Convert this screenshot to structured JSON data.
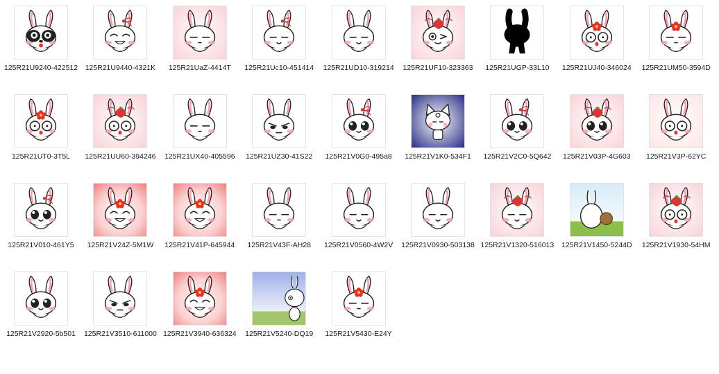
{
  "window": {
    "view": "file-explorer-thumbnails"
  },
  "colors": {
    "caption_text": "#1a1a1a",
    "thumb_border": "#e3e3e3",
    "pink_bg": "#f9d3d8",
    "blush": "#f7a2ad",
    "ribbon": "#cf3b3b",
    "flower": "#e8302a",
    "sky": "#b8c7ee",
    "grass": "#8cbf4a"
  },
  "files": [
    {
      "name": "125R21U9240-422512",
      "icon": "panda-bunny-icon",
      "bg": "white",
      "variant": "panda"
    },
    {
      "name": "125R21U9440-4321K",
      "icon": "bunny-grin-bow-icon",
      "bg": "white",
      "variant": "grin",
      "accessory": "bow"
    },
    {
      "name": "125R21UaZ-4414T",
      "icon": "bunny-flat-pink-icon",
      "bg": "pink",
      "variant": "flat"
    },
    {
      "name": "125R21Uc10-451414",
      "icon": "bunny-smile-bow-icon",
      "bg": "white",
      "variant": "smile",
      "accessory": "bow"
    },
    {
      "name": "125R21UD10-319214",
      "icon": "bunny-wave-icon",
      "bg": "white",
      "variant": "smile"
    },
    {
      "name": "125R21UF10-323363",
      "icon": "bunny-wink-pink-icon",
      "bg": "pink",
      "variant": "wink",
      "accessory": "strawberry"
    },
    {
      "name": "125R21UGP-33L10",
      "icon": "bunny-silhouette-icon",
      "bg": "white",
      "variant": "silhouette"
    },
    {
      "name": "125R21UJ40-346024",
      "icon": "bunny-scared-flower-icon",
      "bg": "white",
      "variant": "wide",
      "accessory": "flower"
    },
    {
      "name": "125R21UM50-3594D",
      "icon": "bunny-sweat-flower-icon",
      "bg": "white",
      "variant": "flat",
      "accessory": "flower"
    },
    {
      "name": "125R21UT0-3T5L",
      "icon": "bunny-stare-flower-icon",
      "bg": "white",
      "variant": "wide",
      "accessory": "flower"
    },
    {
      "name": "125R21UU60-394246",
      "icon": "bunny-shock-pink-icon",
      "bg": "pink",
      "variant": "wide",
      "accessory": "strawberry"
    },
    {
      "name": "125R21UX40-405596",
      "icon": "bunny-carrot-icon",
      "bg": "white",
      "variant": "flat"
    },
    {
      "name": "125R21UZ30-41S22",
      "icon": "bunny-angry-icon",
      "bg": "white",
      "variant": "angry"
    },
    {
      "name": "125R21V0G0-495a8",
      "icon": "bunny-teary-bow-icon",
      "bg": "white",
      "variant": "big",
      "accessory": "bow"
    },
    {
      "name": "125R21V1K0-534F1",
      "icon": "cat-costume-icon",
      "bg": "navy",
      "variant": "cat"
    },
    {
      "name": "125R21V2C0-5Q642",
      "icon": "bunny-cry-bow-icon",
      "bg": "white",
      "variant": "big",
      "accessory": "bow"
    },
    {
      "name": "125R21V03P-4G603",
      "icon": "bunny-surprise-pink-icon",
      "bg": "pink",
      "variant": "big",
      "accessory": "strawberry"
    },
    {
      "name": "125R21V3P-62YC",
      "icon": "bunny-round-eyes-icon",
      "bg": "pinklight",
      "variant": "wide"
    },
    {
      "name": "125R21V010-461Y5",
      "icon": "bunny-teary-icon",
      "bg": "white",
      "variant": "big",
      "accessory": "bow"
    },
    {
      "name": "125R21V24Z-5M1W",
      "icon": "bunny-laugh-flower-icon",
      "bg": "pinkglow",
      "variant": "grin",
      "accessory": "flower"
    },
    {
      "name": "125R21V41P-645944",
      "icon": "bunny-cry-flower-icon",
      "bg": "pinkglow",
      "variant": "grin",
      "accessory": "flower"
    },
    {
      "name": "125R21V43F-AH28",
      "icon": "bunny-smug-icon",
      "bg": "white",
      "variant": "flat"
    },
    {
      "name": "125R21V0560-4W2V",
      "icon": "bunny-content-icon",
      "bg": "white",
      "variant": "smile"
    },
    {
      "name": "125R21V0930-503138",
      "icon": "bunny-good-morning-icon",
      "bg": "white",
      "variant": "smile"
    },
    {
      "name": "125R21V1320-516013",
      "icon": "bunny-happy-pink-icon",
      "bg": "pink",
      "variant": "smile",
      "accessory": "strawberry"
    },
    {
      "name": "125R21V1450-5244D",
      "icon": "bunny-field-icon",
      "bg": "field",
      "variant": "back"
    },
    {
      "name": "125R21V1930-54HM",
      "icon": "bunny-round-pink-icon",
      "bg": "pink",
      "variant": "wide",
      "accessory": "strawberry"
    },
    {
      "name": "125R21V2920-5b501",
      "icon": "bunny-blush-icon",
      "bg": "white",
      "variant": "big"
    },
    {
      "name": "125R21V3510-611000",
      "icon": "bunny-armor-icon",
      "bg": "white",
      "variant": "angry"
    },
    {
      "name": "125R21V3940-636324",
      "icon": "bunny-cry-flower-icon",
      "bg": "pinkglow",
      "variant": "grin",
      "accessory": "flower"
    },
    {
      "name": "125R21V5240-DQ19",
      "icon": "bunny-peek-icon",
      "bg": "sky",
      "variant": "peek"
    },
    {
      "name": "125R21V5430-E24Y",
      "icon": "bunny-sleepy-flower-icon",
      "bg": "white",
      "variant": "flat",
      "accessory": "flower"
    }
  ]
}
